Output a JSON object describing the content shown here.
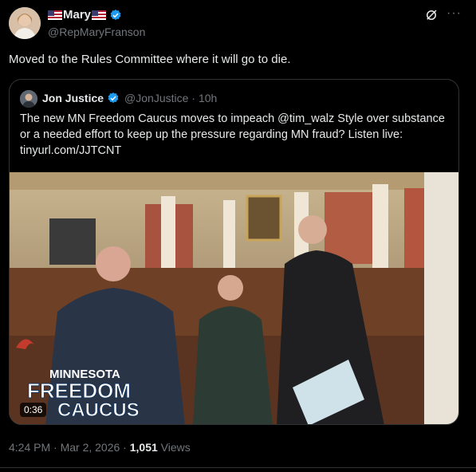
{
  "author": {
    "display_name": "Mary",
    "handle": "@RepMaryFranson",
    "avatar": "profile-photo"
  },
  "tweet": {
    "text": "Moved to the Rules Committee where it will go to die.",
    "posted_time": "4:24 PM · Mar 2, 2026",
    "separator": " · ",
    "views_count": "1,051",
    "views_label": " Views"
  },
  "quote": {
    "author_name": "Jon Justice",
    "author_handle": "@JonJustice",
    "time": "· 10h",
    "text": "The new MN Freedom Caucus moves to impeach @tim_walz Style over substance or a needed effort to keep up the pressure regarding MN fraud? Listen live: tinyurl.com/JJTCNT",
    "video": {
      "duration": "0:36",
      "overlay_line1": "MINNESOTA",
      "overlay_line2": "FREEDOM",
      "overlay_line3": "CAUCUS"
    }
  },
  "icons": [
    "verified-badge-icon",
    "grok-icon",
    "more-icon",
    "us-flag-icon"
  ],
  "colors": {
    "background": "#000000",
    "text": "#e7e9ea",
    "secondary": "#71767b",
    "verified": "#1d9bf0",
    "border": "#2f3336"
  }
}
